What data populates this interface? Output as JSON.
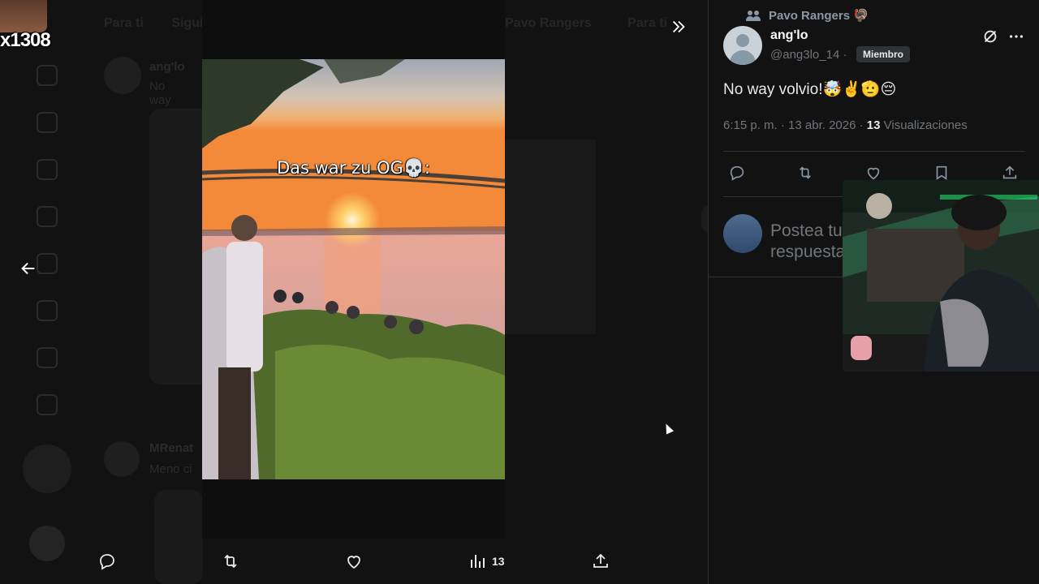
{
  "streamer": {
    "tag": "x1308"
  },
  "background": {
    "tabs_left": [
      "Para ti",
      "Siguiendo"
    ],
    "tabs_right": [
      "Pavo Rangers",
      "Para ti"
    ],
    "post1": {
      "name": "ang'lo",
      "text": "No way"
    },
    "post2": {
      "name": "MRenat",
      "text": "Meno ci"
    }
  },
  "media": {
    "caption": "Das war zu OG💀:"
  },
  "actions": {
    "views_count": "13"
  },
  "right_panel": {
    "community": "Pavo Rangers",
    "community_emoji": "🦃",
    "author_name": "ang'lo",
    "author_handle": "@ang3lo_14 ·",
    "member_badge": "Miembro",
    "tweet_text": "No way volvio!🤯✌️🫡😔",
    "meta_time": "6:15 p. m. · 13 abr. 2026 ·",
    "meta_views_count": "13",
    "meta_views_label": "Visualizaciones",
    "reply_placeholder": "Postea tu respuesta"
  },
  "colors": {
    "background": "#121212",
    "text_primary": "#e7e9ea",
    "text_secondary": "#71767b",
    "border": "#2f3336",
    "badge_bg": "#2f3336"
  },
  "icons": [
    "arrow-left-icon",
    "chevrons-right-icon",
    "reply-icon",
    "retweet-icon",
    "like-icon",
    "views-icon",
    "share-icon",
    "bookmark-icon",
    "grok-icon",
    "more-icon",
    "group-icon"
  ]
}
